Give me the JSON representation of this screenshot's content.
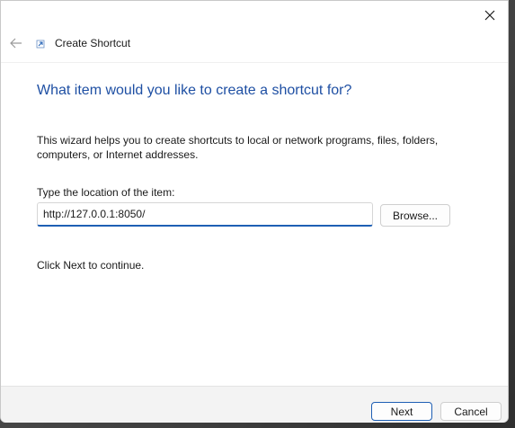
{
  "header": {
    "title": "Create Shortcut"
  },
  "main": {
    "heading": "What item would you like to create a shortcut for?",
    "description": "This wizard helps you to create shortcuts to local or network programs, files, folders, computers, or Internet addresses.",
    "location_label": "Type the location of the item:",
    "location_value": "http://127.0.0.1:8050/",
    "browse_label": "Browse...",
    "continue_text": "Click Next to continue."
  },
  "footer": {
    "next_label": "Next",
    "cancel_label": "Cancel"
  },
  "colors": {
    "accent": "#1e5fb4",
    "heading": "#1e4fa3"
  },
  "icons": {
    "close": "close-icon",
    "back": "back-arrow-icon",
    "app": "shortcut-icon"
  }
}
